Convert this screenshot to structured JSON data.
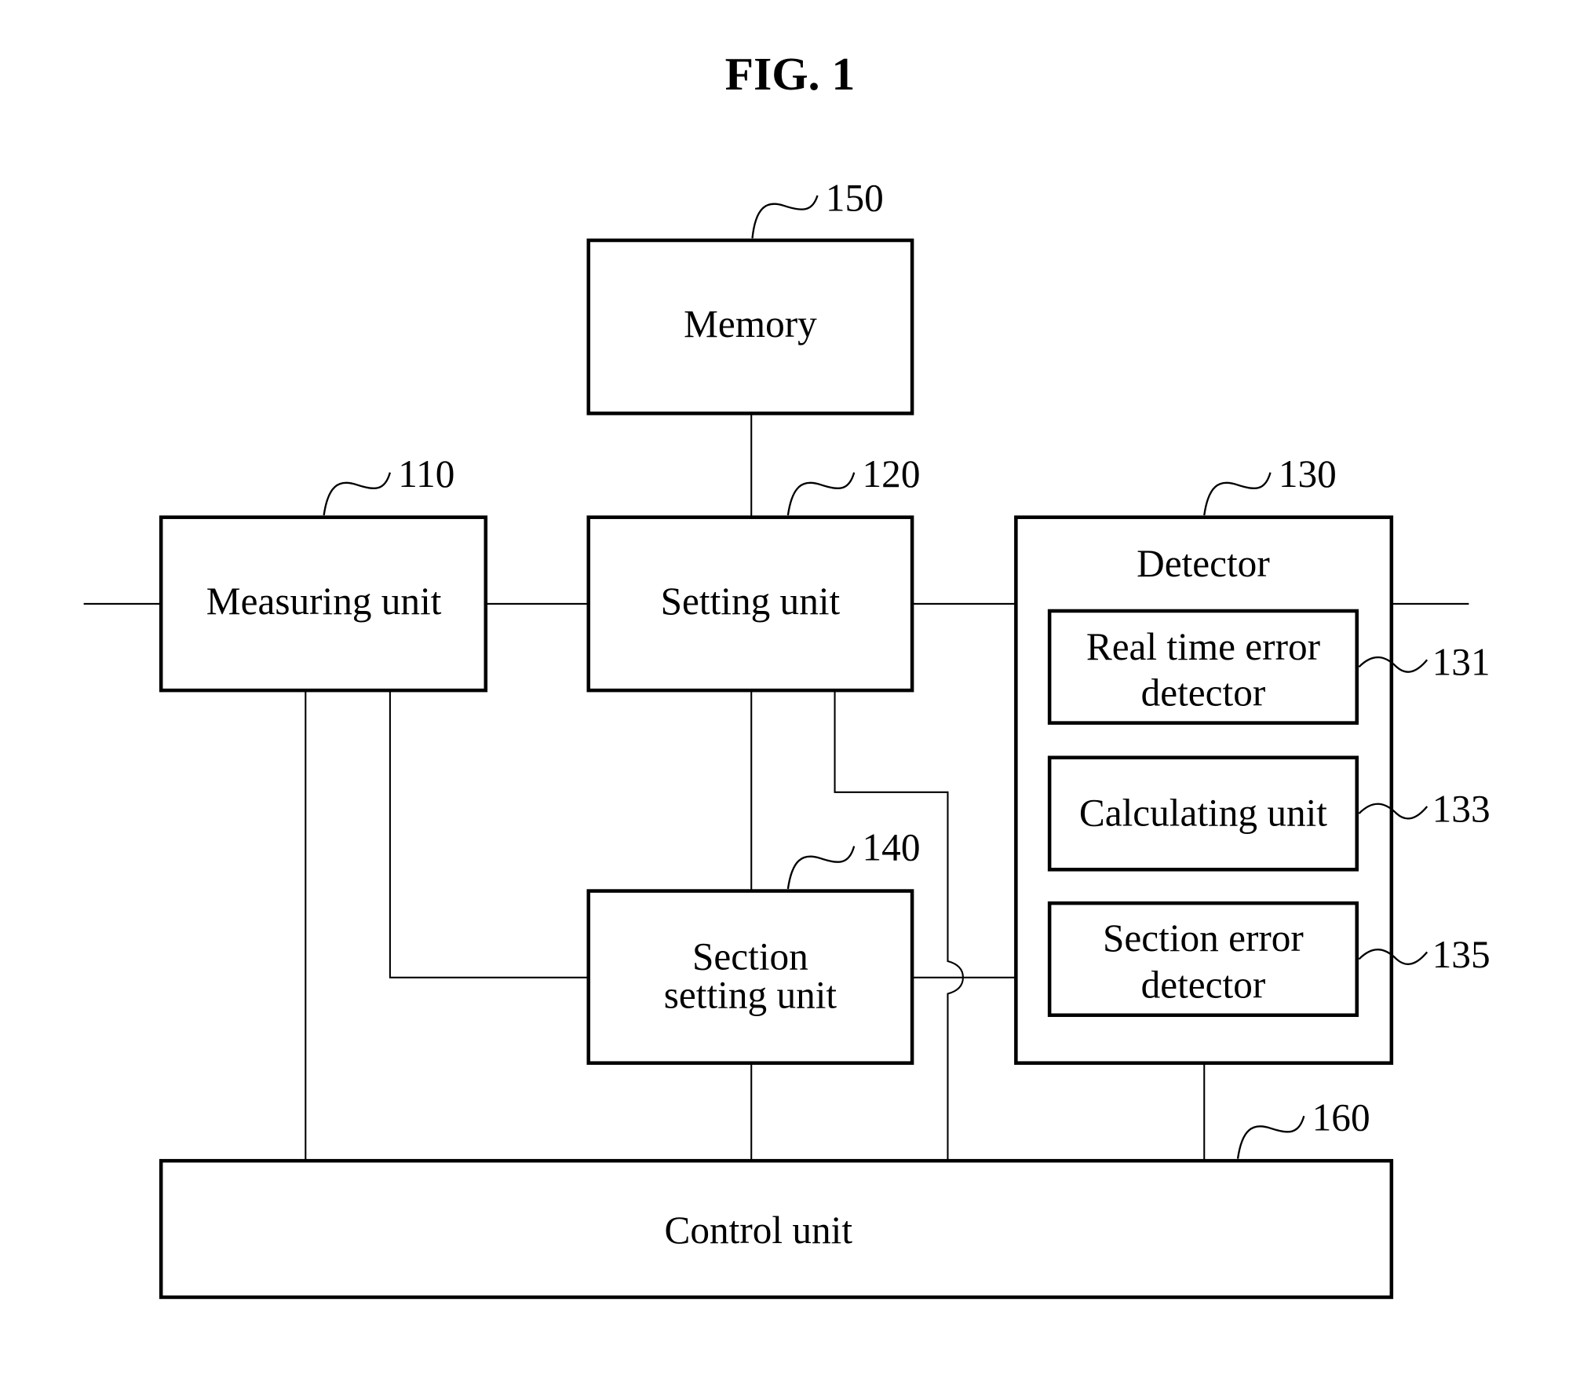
{
  "figure": {
    "title": "FIG. 1",
    "blocks": {
      "memory": {
        "label": "Memory",
        "ref": "150"
      },
      "measuring": {
        "label": "Measuring unit",
        "ref": "110"
      },
      "setting": {
        "label": "Setting unit",
        "ref": "120"
      },
      "detector": {
        "label": "Detector",
        "ref": "130"
      },
      "realtime": {
        "line1": "Real time error",
        "line2": "detector",
        "ref": "131"
      },
      "calculating": {
        "label": "Calculating unit",
        "ref": "133"
      },
      "section_error": {
        "line1": "Section error",
        "line2": "detector",
        "ref": "135"
      },
      "section_setting": {
        "line1": "Section",
        "line2": "setting unit",
        "ref": "140"
      },
      "control": {
        "label": "Control unit",
        "ref": "160"
      }
    }
  }
}
